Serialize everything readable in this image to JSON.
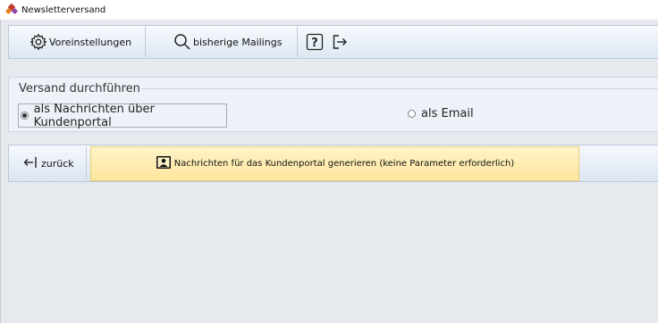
{
  "window": {
    "title": "Newsletterversand",
    "icon": "app-diamond-icon"
  },
  "toolbar": {
    "presets_label": "Voreinstellungen",
    "presets_icon": "gear-icon",
    "mailings_label": "bisherige Mailings",
    "mailings_icon": "search-icon",
    "help_icon": "help-icon",
    "exit_icon": "exit-icon"
  },
  "dispatch": {
    "group_title": "Versand durchführen",
    "options": [
      {
        "label": "als Nachrichten über Kundenportal",
        "selected": true
      },
      {
        "label": "als Email",
        "selected": false
      }
    ]
  },
  "actions": {
    "back_label": "zurück",
    "back_icon": "arrow-left-icon",
    "generate_label": "Nachrichten für das Kundenportal generieren (keine Parameter erforderlich)",
    "generate_icon": "portal-contact-icon",
    "generate_color": "#fde59c"
  }
}
